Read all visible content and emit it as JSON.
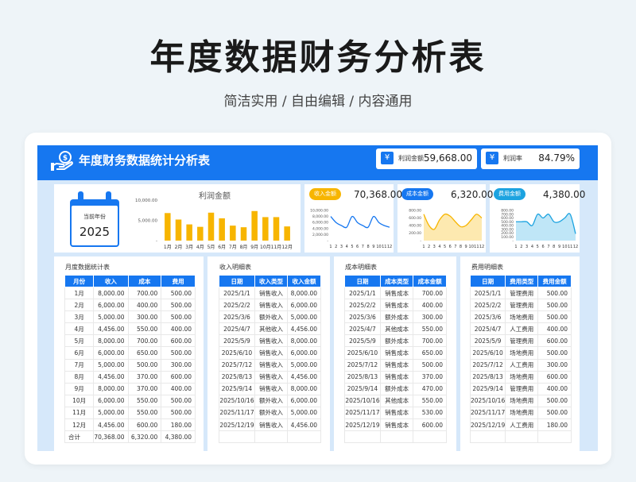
{
  "page": {
    "title": "年度数据财务分析表",
    "subtitle": "简洁实用 / 自由编辑 / 内容通用"
  },
  "header": {
    "title": "年度财务数据统计分析表",
    "icon": "money-hand-icon"
  },
  "kpis": [
    {
      "label": "利润金额",
      "value": "59,668.00",
      "icon": "yen-icon"
    },
    {
      "label": "利润率",
      "value": "84.79%",
      "icon": "yen-icon"
    }
  ],
  "calendar": {
    "label": "当前年份",
    "year": "2025"
  },
  "profit_chart": {
    "title": "利润金额",
    "y_ticks": [
      "10,000.00",
      "5,000.00",
      "-"
    ]
  },
  "mini_charts": [
    {
      "badge": "收入金额",
      "badge_color": "#f7b500",
      "value": "70,368.00",
      "color": "#1677f0",
      "fill": "none",
      "y_ticks": [
        "10,000.00",
        "8,000.00",
        "6,000.00",
        "4,000.00",
        "2,000.00",
        "-"
      ],
      "x_labels": [
        "1",
        "2",
        "3",
        "4",
        "5",
        "6",
        "7",
        "8",
        "9",
        "10",
        "11",
        "12"
      ]
    },
    {
      "badge": "成本金额",
      "badge_color": "#1677f0",
      "value": "6,320.00",
      "color": "#f7b500",
      "fill": "#fde9b0",
      "y_ticks": [
        "800.00",
        "600.00",
        "400.00",
        "200.00",
        "-"
      ],
      "x_labels": [
        "1",
        "2",
        "3",
        "4",
        "5",
        "6",
        "7",
        "8",
        "9",
        "10",
        "11",
        "12"
      ]
    },
    {
      "badge": "费用金额",
      "badge_color": "#1ca3e0",
      "value": "4,380.00",
      "color": "#1ca3e0",
      "fill": "#bfe6f7",
      "y_ticks": [
        "800.00",
        "700.00",
        "600.00",
        "500.00",
        "400.00",
        "300.00",
        "200.00",
        "100.00",
        "-"
      ],
      "x_labels": [
        "1",
        "2",
        "3",
        "4",
        "5",
        "6",
        "7",
        "8",
        "9",
        "10",
        "11",
        "12"
      ]
    }
  ],
  "chart_data": [
    {
      "type": "bar",
      "title": "利润金额",
      "categories": [
        "1月",
        "2月",
        "3月",
        "4月",
        "5月",
        "6月",
        "7月",
        "8月",
        "9月",
        "10月",
        "11月",
        "12月"
      ],
      "values": [
        6800,
        5200,
        4000,
        3400,
        6900,
        5500,
        3700,
        3300,
        7300,
        5800,
        5800,
        3500
      ],
      "ylim": [
        0,
        10000
      ],
      "color": "#f7b500"
    },
    {
      "type": "line",
      "title": "收入金额",
      "categories": [
        "1",
        "2",
        "3",
        "4",
        "5",
        "6",
        "7",
        "8",
        "9",
        "10",
        "11",
        "12"
      ],
      "values": [
        8000,
        6000,
        5000,
        4456,
        8000,
        6000,
        5000,
        4456,
        8000,
        6000,
        5000,
        4456
      ],
      "ylim": [
        0,
        10000
      ]
    },
    {
      "type": "area",
      "title": "成本金额",
      "categories": [
        "1",
        "2",
        "3",
        "4",
        "5",
        "6",
        "7",
        "8",
        "9",
        "10",
        "11",
        "12"
      ],
      "values": [
        700,
        400,
        300,
        550,
        700,
        650,
        500,
        370,
        400,
        550,
        700,
        600
      ],
      "ylim": [
        0,
        800
      ]
    },
    {
      "type": "area",
      "title": "费用金额",
      "categories": [
        "1",
        "2",
        "3",
        "4",
        "5",
        "6",
        "7",
        "8",
        "9",
        "10",
        "11",
        "12"
      ],
      "values": [
        500,
        500,
        500,
        400,
        700,
        600,
        700,
        500,
        500,
        600,
        700,
        180
      ],
      "ylim": [
        0,
        800
      ]
    }
  ],
  "tables": {
    "monthly": {
      "title": "月度数据统计表",
      "headers": [
        "月份",
        "收入",
        "成本",
        "费用"
      ],
      "rows": [
        [
          "1月",
          "8,000.00",
          "700.00",
          "500.00"
        ],
        [
          "2月",
          "6,000.00",
          "400.00",
          "500.00"
        ],
        [
          "3月",
          "5,000.00",
          "300.00",
          "500.00"
        ],
        [
          "4月",
          "4,456.00",
          "550.00",
          "400.00"
        ],
        [
          "5月",
          "8,000.00",
          "700.00",
          "600.00"
        ],
        [
          "6月",
          "6,000.00",
          "650.00",
          "500.00"
        ],
        [
          "7月",
          "5,000.00",
          "500.00",
          "300.00"
        ],
        [
          "8月",
          "4,456.00",
          "370.00",
          "600.00"
        ],
        [
          "9月",
          "8,000.00",
          "370.00",
          "400.00"
        ],
        [
          "10月",
          "6,000.00",
          "550.00",
          "500.00"
        ],
        [
          "11月",
          "5,000.00",
          "550.00",
          "500.00"
        ],
        [
          "12月",
          "4,456.00",
          "600.00",
          "180.00"
        ],
        [
          "合计",
          "70,368.00",
          "6,320.00",
          "4,380.00"
        ]
      ]
    },
    "income": {
      "title": "收入明细表",
      "headers": [
        "日期",
        "收入类型",
        "收入金额"
      ],
      "rows": [
        [
          "2025/1/1",
          "销售收入",
          "8,000.00"
        ],
        [
          "2025/2/2",
          "销售收入",
          "6,000.00"
        ],
        [
          "2025/3/6",
          "额外收入",
          "5,000.00"
        ],
        [
          "2025/4/7",
          "其他收入",
          "4,456.00"
        ],
        [
          "2025/5/9",
          "销售收入",
          "8,000.00"
        ],
        [
          "2025/6/10",
          "销售收入",
          "6,000.00"
        ],
        [
          "2025/7/12",
          "销售收入",
          "5,000.00"
        ],
        [
          "2025/8/13",
          "销售收入",
          "4,456.00"
        ],
        [
          "2025/9/14",
          "销售收入",
          "8,000.00"
        ],
        [
          "2025/10/16",
          "额外收入",
          "6,000.00"
        ],
        [
          "2025/11/17",
          "额外收入",
          "5,000.00"
        ],
        [
          "2025/12/19",
          "销售收入",
          "4,456.00"
        ],
        [
          "",
          "",
          ""
        ]
      ]
    },
    "cost": {
      "title": "成本明细表",
      "headers": [
        "日期",
        "成本类型",
        "成本金额"
      ],
      "rows": [
        [
          "2025/1/1",
          "销售成本",
          "700.00"
        ],
        [
          "2025/2/2",
          "销售成本",
          "400.00"
        ],
        [
          "2025/3/6",
          "额外成本",
          "300.00"
        ],
        [
          "2025/4/7",
          "其他成本",
          "550.00"
        ],
        [
          "2025/5/9",
          "额外成本",
          "700.00"
        ],
        [
          "2025/6/10",
          "销售成本",
          "650.00"
        ],
        [
          "2025/7/12",
          "销售成本",
          "500.00"
        ],
        [
          "2025/8/13",
          "销售成本",
          "370.00"
        ],
        [
          "2025/9/14",
          "额外成本",
          "470.00"
        ],
        [
          "2025/10/16",
          "其他成本",
          "550.00"
        ],
        [
          "2025/11/17",
          "销售成本",
          "530.00"
        ],
        [
          "2025/12/19",
          "销售成本",
          "600.00"
        ],
        [
          "",
          "",
          ""
        ]
      ]
    },
    "expense": {
      "title": "费用明细表",
      "headers": [
        "日期",
        "费用类型",
        "费用金额"
      ],
      "rows": [
        [
          "2025/1/1",
          "管理费用",
          "500.00"
        ],
        [
          "2025/2/2",
          "管理费用",
          "500.00"
        ],
        [
          "2025/3/6",
          "场地费用",
          "500.00"
        ],
        [
          "2025/4/7",
          "人工费用",
          "400.00"
        ],
        [
          "2025/5/9",
          "管理费用",
          "600.00"
        ],
        [
          "2025/6/10",
          "场地费用",
          "500.00"
        ],
        [
          "2025/7/12",
          "人工费用",
          "300.00"
        ],
        [
          "2025/8/13",
          "场地费用",
          "600.00"
        ],
        [
          "2025/9/14",
          "管理费用",
          "400.00"
        ],
        [
          "2025/10/16",
          "场地费用",
          "500.00"
        ],
        [
          "2025/11/17",
          "场地费用",
          "500.00"
        ],
        [
          "2025/12/19",
          "人工费用",
          "180.00"
        ],
        [
          "",
          "",
          ""
        ]
      ]
    }
  }
}
